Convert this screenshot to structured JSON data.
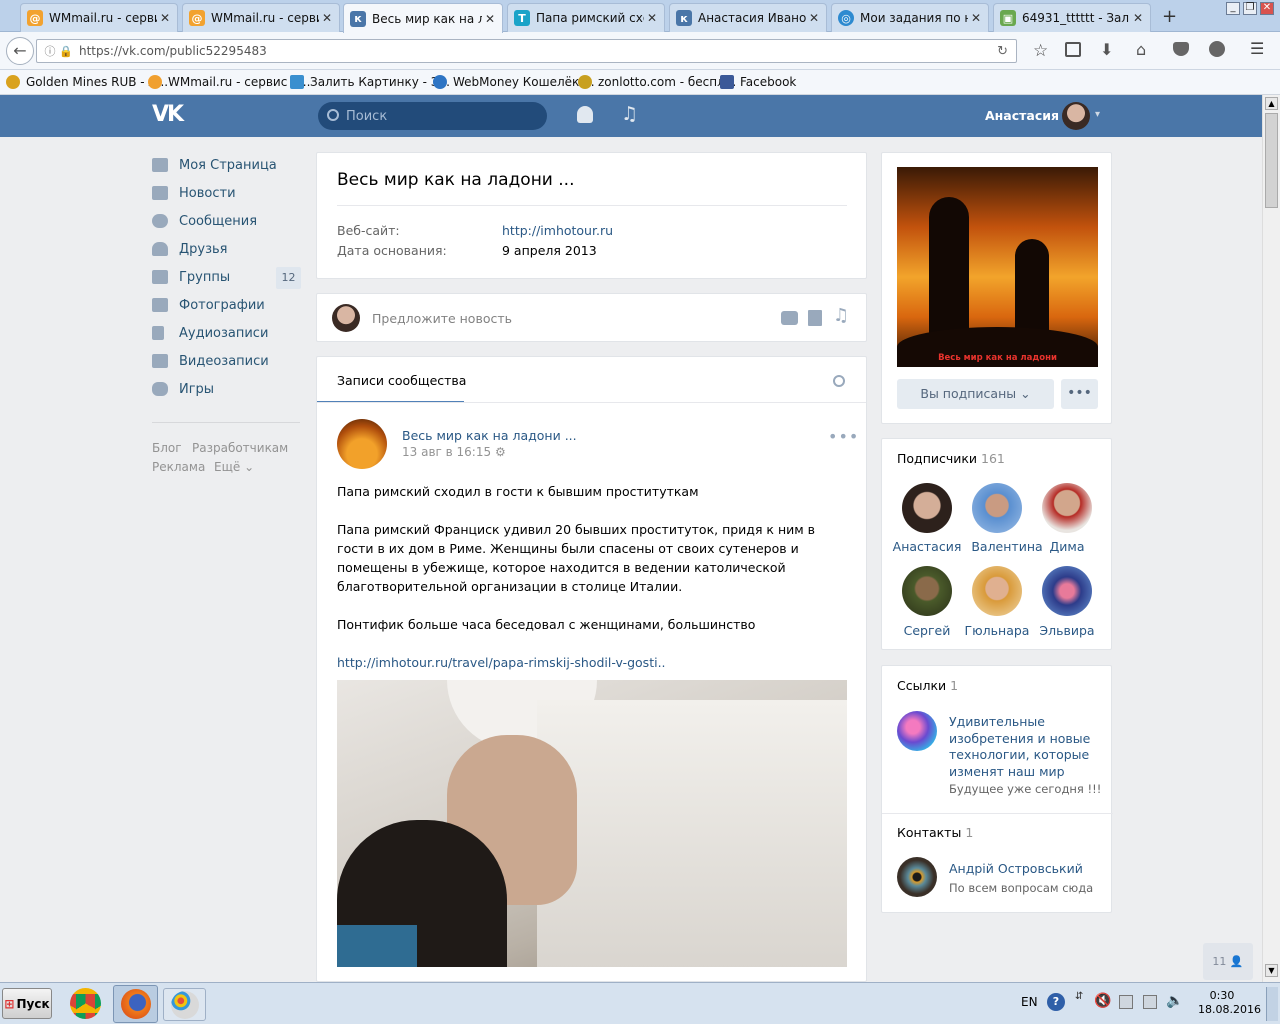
{
  "browser": {
    "tabs": [
      {
        "title": "WMmail.ru - сервис...",
        "icon": "wmmail-icon",
        "active": false
      },
      {
        "title": "WMmail.ru - сервис...",
        "icon": "wmmail-icon",
        "active": false
      },
      {
        "title": "Весь мир как на ла...",
        "icon": "vk-icon",
        "active": true
      },
      {
        "title": "Папа римский сход...",
        "icon": "t-icon",
        "active": false
      },
      {
        "title": "Анастасия Иванова",
        "icon": "vk-icon",
        "active": false
      },
      {
        "title": "Мои задания по на...",
        "icon": "task-icon",
        "active": false
      },
      {
        "title": "64931_tttttt - Зали...",
        "icon": "image-icon",
        "active": false
      }
    ],
    "new_tab_label": "+",
    "url": "https://vk.com/public52295483",
    "bookmarks": [
      {
        "label": "Golden Mines RUB - А...",
        "color": "#d9a21e"
      },
      {
        "label": "WMmail.ru - сервис п...",
        "color": "#f0a030"
      },
      {
        "label": "Залить Картинку - З...",
        "color": "#3a8fcf"
      },
      {
        "label": "WebMoney Кошелёк ...",
        "color": "#2d74c4"
      },
      {
        "label": "zonlotto.com - беспл...",
        "color": "#c8a020"
      },
      {
        "label": "Facebook",
        "color": "#3b5998"
      }
    ]
  },
  "vk": {
    "search_placeholder": "Поиск",
    "user_name": "Анастасия",
    "menu": [
      {
        "label": "Моя Страница",
        "icon": "home-icon"
      },
      {
        "label": "Новости",
        "icon": "news-icon"
      },
      {
        "label": "Сообщения",
        "icon": "messages-icon"
      },
      {
        "label": "Друзья",
        "icon": "friends-icon"
      },
      {
        "label": "Группы",
        "icon": "groups-icon",
        "badge": "12"
      },
      {
        "label": "Фотографии",
        "icon": "camera-icon"
      },
      {
        "label": "Аудиозаписи",
        "icon": "music-icon"
      },
      {
        "label": "Видеозаписи",
        "icon": "video-icon"
      },
      {
        "label": "Игры",
        "icon": "gamepad-icon"
      }
    ],
    "footer_links": [
      "Блог",
      "Разработчикам",
      "Реклама",
      "Ещё"
    ],
    "group": {
      "name": "Весь мир как на ладони ...",
      "website_label": "Веб-сайт:",
      "website": "http://imhotour.ru",
      "founded_label": "Дата основания:",
      "founded": "9 апреля 2013"
    },
    "suggest_placeholder": "Предложите новость",
    "wall_tab": "Записи сообщества",
    "post": {
      "author": "Весь мир как на ладони ...",
      "date": "13 авг в 16:15",
      "title": "Папа римский сходил в гости к бывшим проституткам",
      "paragraph1": "Папа римский Франциск удивил 20 бывших проституток, придя к ним в гости в их дом в Риме. Женщины были спасены от своих сутенеров и помещены в убежище, которое находится в ведении католической благотворительной организации в столице Италии.",
      "paragraph2": "Понтифик больше часа беседовал с женщинами, большинство",
      "link": "http://imhotour.ru/travel/papa-rimskij-shodil-v-gosti.."
    },
    "cover_caption": "Весь мир как на ладони",
    "subscribe_button": "Вы подписаны",
    "subscribers": {
      "title": "Подписчики",
      "count": "161",
      "people": [
        "Анастасия",
        "Валентина",
        "Дима",
        "Сергей",
        "Гюльнара",
        "Эльвира"
      ]
    },
    "links": {
      "title": "Ссылки",
      "count": "1",
      "item_title": "Удивительные изобретения и новые технологии, которые изменят наш мир",
      "item_desc": "Будущее уже сегодня !!!"
    },
    "contacts": {
      "title": "Контакты",
      "count": "1",
      "name": "Андрій Островський",
      "desc": "По всем вопросам сюда"
    },
    "online_count": "11"
  },
  "taskbar": {
    "start": "Пуск",
    "lang": "EN",
    "time": "0:30",
    "date": "18.08.2016"
  },
  "colors": {
    "vk_blue": "#4a76a8",
    "link": "#2a5885",
    "page_bg": "#edeef0"
  }
}
